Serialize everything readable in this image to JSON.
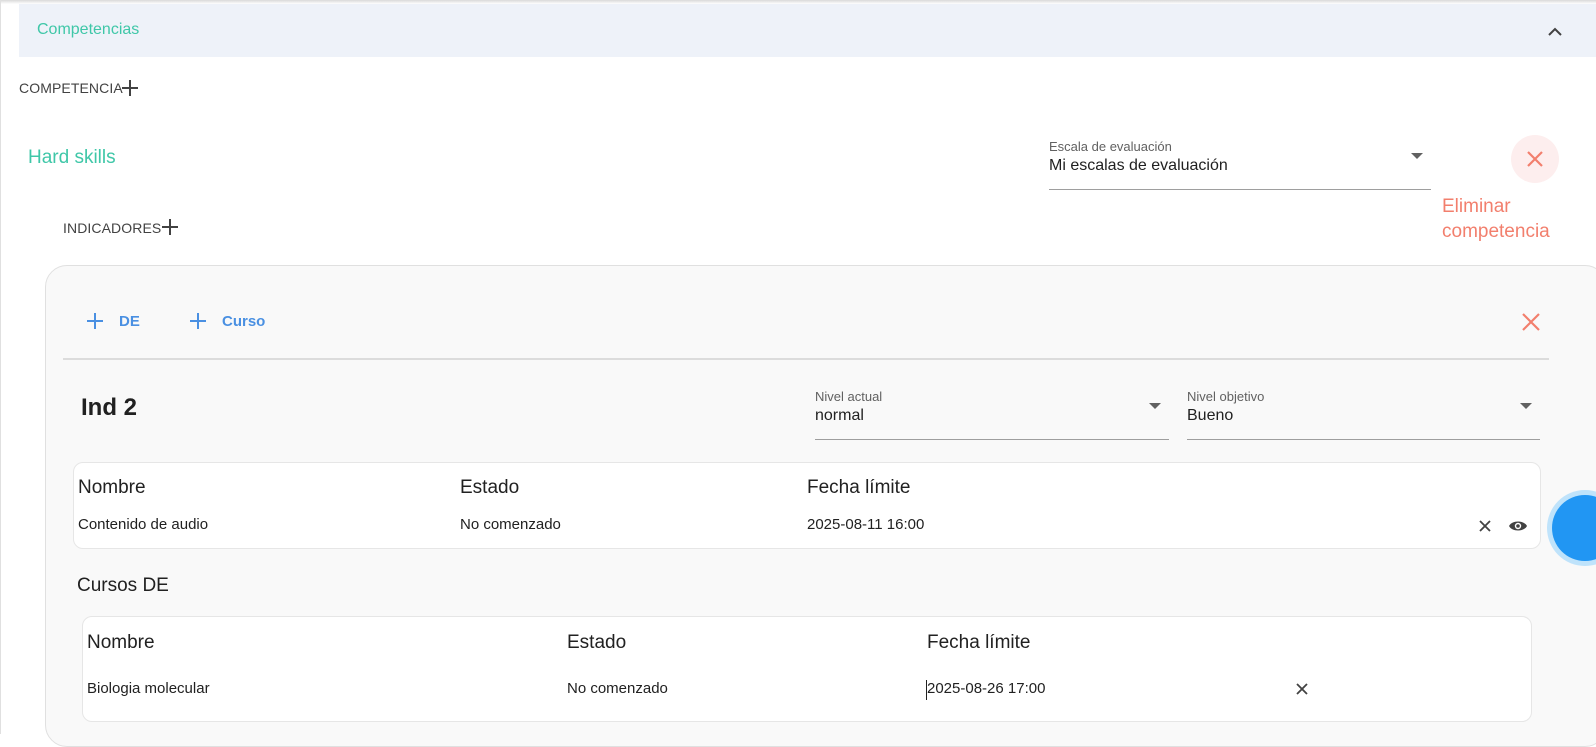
{
  "section": {
    "title": "Competencias"
  },
  "competencia": {
    "add_label": "COMPETENCIA"
  },
  "skill": {
    "title": "Hard skills",
    "scale": {
      "label": "Escala de evaluación",
      "value": "Mi escalas de evaluación"
    },
    "delete_label": "Eliminar competencia"
  },
  "indicadores": {
    "add_label": "INDICADORES"
  },
  "card": {
    "buttons": {
      "add_de": "DE",
      "add_curso": "Curso"
    },
    "indicator_title": "Ind 2",
    "nivel_actual": {
      "label": "Nivel actual",
      "value": "normal"
    },
    "nivel_objetivo": {
      "label": "Nivel objetivo",
      "value": "Bueno"
    },
    "table1": {
      "headers": [
        "Nombre",
        "Estado",
        "Fecha límite"
      ],
      "rows": [
        {
          "nombre": "Contenido de audio",
          "estado": "No comenzado",
          "fecha": "2025-08-11 16:00"
        }
      ]
    },
    "cursos_de_title": "Cursos DE",
    "table2": {
      "headers": [
        "Nombre",
        "Estado",
        "Fecha límite"
      ],
      "rows": [
        {
          "nombre": "Biologia molecular",
          "estado": "No comenzado",
          "fecha": "2025-08-26 17:00"
        }
      ]
    }
  },
  "colors": {
    "accent_teal": "#3fc7a8",
    "danger": "#f27f6d",
    "link_blue": "#4a90e2",
    "header_bg": "#eef2f9",
    "fab_blue": "#2196f3"
  },
  "icons": [
    "chevron-up-icon",
    "plus-icon",
    "close-icon",
    "caret-down-icon",
    "eye-icon"
  ]
}
